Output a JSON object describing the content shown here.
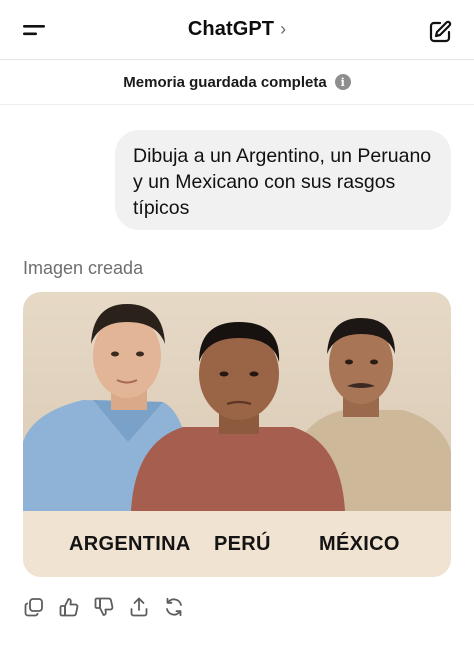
{
  "header": {
    "title": "ChatGPT",
    "title_chevron": "›"
  },
  "memory_bar": {
    "text": "Memoria guardada completa",
    "info_glyph": "i"
  },
  "conversation": {
    "user_message": "Dibuja a un Argentino, un Peruano y un Mexicano con sus rasgos típicos",
    "image_label": "Imagen creada"
  },
  "generated_image": {
    "captions": [
      "ARGENTINA",
      "PERÚ",
      "MÉXICO"
    ]
  },
  "icons": {
    "menu": "menu-icon",
    "edit": "compose-icon",
    "actions": [
      "copy-icon",
      "thumbs-up-icon",
      "thumbs-down-icon",
      "share-icon",
      "regenerate-icon"
    ]
  }
}
